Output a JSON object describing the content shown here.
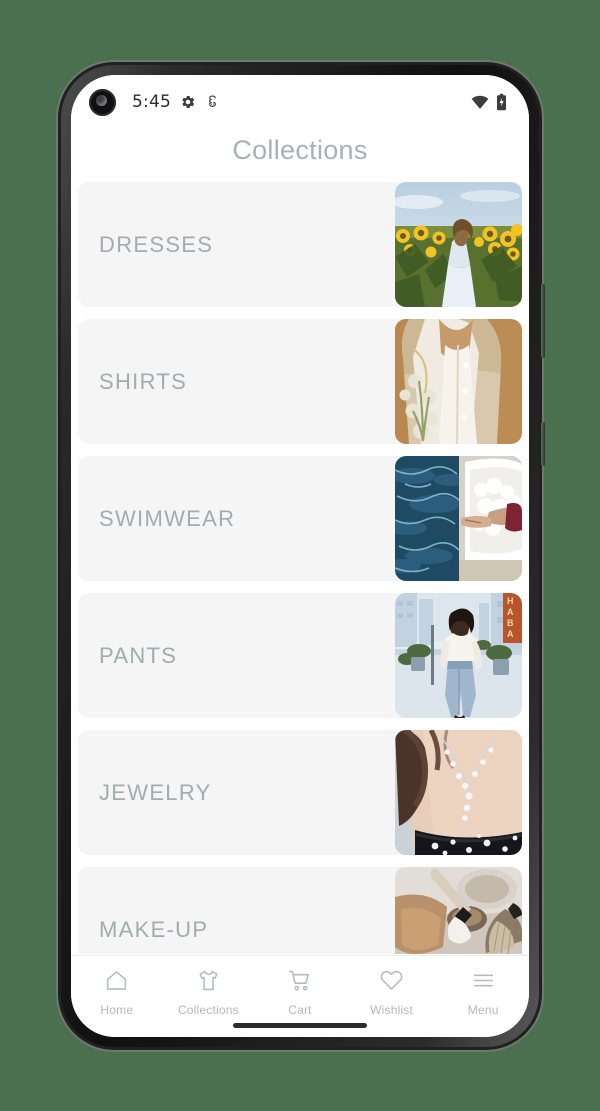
{
  "device": {
    "frame_color": "#1a1a1a",
    "background_color": "#4a7050"
  },
  "status_bar": {
    "time": "5:45",
    "icons_left": [
      "gear-icon",
      "android-head-icon"
    ],
    "icons_right": [
      "wifi-icon",
      "battery-charging-icon"
    ]
  },
  "header": {
    "title": "Collections",
    "title_color": "#a5b3b6"
  },
  "collections": [
    {
      "label": "DRESSES",
      "image": "woman-in-white-dress-walking-through-sunflower-field"
    },
    {
      "label": "SHIRTS",
      "image": "woman-in-cream-blouse-holding-white-flowers"
    },
    {
      "label": "SWIMWEAR",
      "image": "person-in-red-swimsuit-on-white-lounger-beside-pool"
    },
    {
      "label": "PANTS",
      "image": "woman-in-jeans-walking-down-city-street"
    },
    {
      "label": "JEWELRY",
      "image": "closeup-of-pearl-necklace-on-neck-with-black-floral-top"
    },
    {
      "label": "MAKE-UP",
      "image": "makeup-brushes-and-powder-compacts"
    }
  ],
  "bottom_nav": [
    {
      "label": "Home",
      "icon": "home-icon"
    },
    {
      "label": "Collections",
      "icon": "tshirt-icon"
    },
    {
      "label": "Cart",
      "icon": "shopping-cart-icon"
    },
    {
      "label": "Wishlist",
      "icon": "heart-icon"
    },
    {
      "label": "Menu",
      "icon": "hamburger-menu-icon"
    }
  ]
}
